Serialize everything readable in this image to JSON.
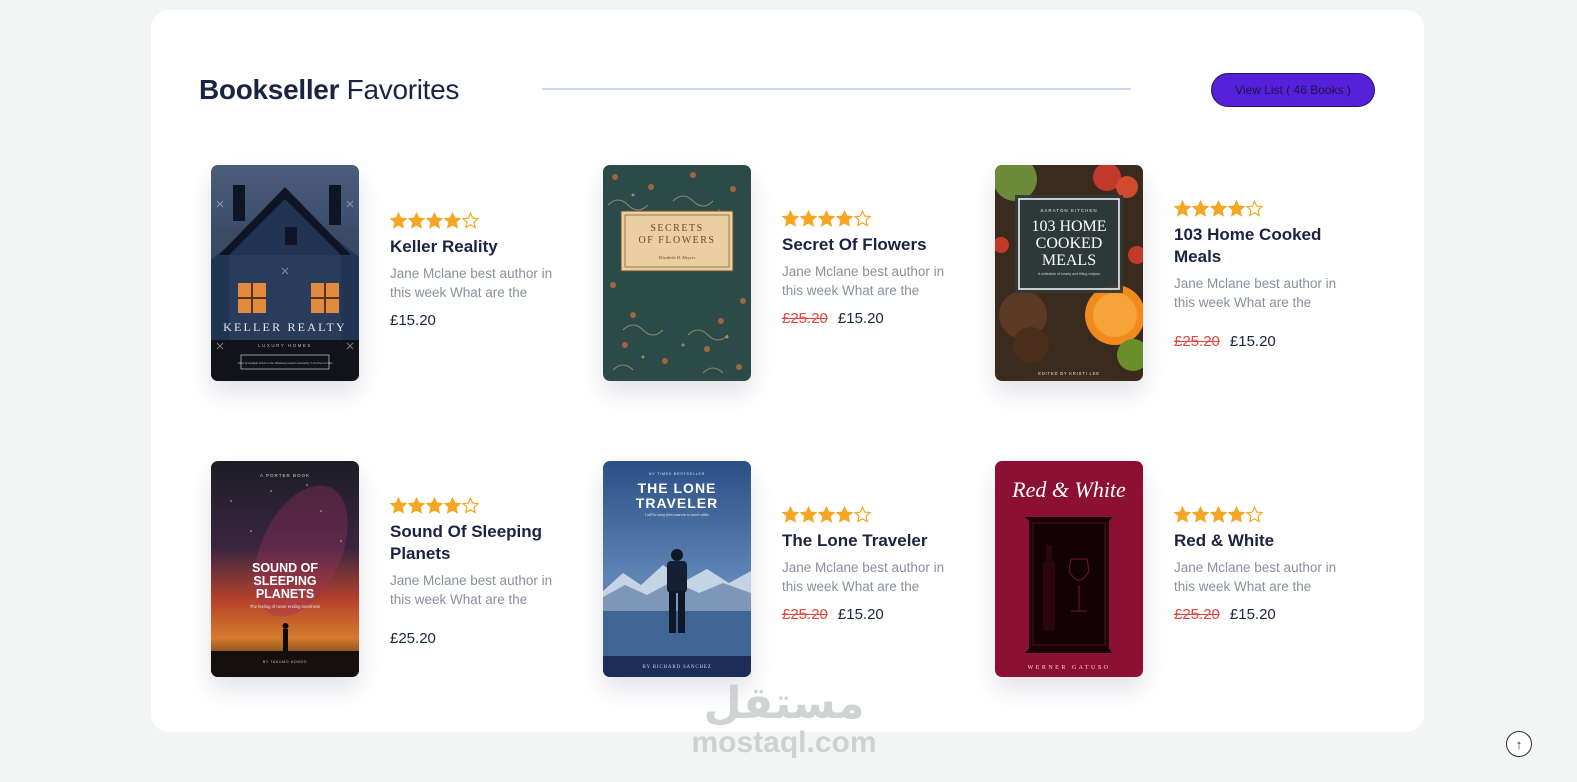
{
  "section": {
    "title_bold": "Bookseller",
    "title_light": "Favorites",
    "view_list_label": "View List ( 46 Books )"
  },
  "colors": {
    "accent": "#5620db",
    "star": "#f5a623",
    "old_price": "#e2453e",
    "heading": "#1a2342"
  },
  "books": [
    {
      "title": "Keller Reality",
      "description": "Jane Mclane best author in this week What are the",
      "rating": 4,
      "max_rating": 5,
      "old_price": "",
      "price": "£15.20",
      "cover": {
        "title": "KELLER REALTY",
        "subtitle": "LUXURY HOMES",
        "tagline": "Tours of multiple homes in the Windsong Gated Community, 5.23.29 at 12-5pm"
      }
    },
    {
      "title": "Secret Of Flowers",
      "description": "Jane Mclane best author in this week What are the",
      "rating": 4,
      "max_rating": 5,
      "old_price": "£25.20",
      "price": "£15.20",
      "cover": {
        "title_line1": "SECRETS",
        "title_line2": "OF FLOWERS",
        "author": "Elizabeth H. Meyers"
      }
    },
    {
      "title": "103 Home Cooked Meals",
      "description": "Jane Mclane best author in this week What are the",
      "rating": 4,
      "max_rating": 5,
      "old_price": "£25.20",
      "price": "£15.20",
      "cover": {
        "publisher": "SARATON KITCHEN",
        "title_line1": "103 HOME",
        "title_line2": "COOKED",
        "title_line3": "MEALS",
        "tagline": "A collection of hearty and filling recipes",
        "editor": "EDITED BY KRISTI LEE"
      }
    },
    {
      "title": "Sound Of Sleeping Planets",
      "description": "Jane Mclane best author in this week What are the",
      "rating": 4,
      "max_rating": 5,
      "old_price": "",
      "price": "£25.20",
      "cover": {
        "publisher": "A PORTER BOOK",
        "title_line1": "SOUND OF",
        "title_line2": "SLEEPING",
        "title_line3": "PLANETS",
        "tagline": "The feeling of never ending loneliness",
        "author": "BY TAKUMO HONDO"
      }
    },
    {
      "title": "The Lone Traveler",
      "description": "Jane Mclane best author in this week What are the",
      "rating": 4,
      "max_rating": 5,
      "old_price": "£25.20",
      "price": "£15.20",
      "cover": {
        "kicker": "NY TIMES BESTSELLER",
        "title_line1": "THE LONE",
        "title_line2": "TRAVELER",
        "tagline": "I will be away from someone to travel within",
        "author": "BY RICHARD SANCHEZ"
      }
    },
    {
      "title": "Red & White",
      "description": "Jane Mclane best author in this week What are the",
      "rating": 4,
      "max_rating": 5,
      "old_price": "£25.20",
      "price": "£15.20",
      "cover": {
        "title": "Red & White",
        "author": "WERNER GATUSO"
      }
    }
  ],
  "watermark": {
    "logo_text": "مستقل",
    "site": "mostaql.com"
  },
  "scroll_top_icon": "arrow-up-icon"
}
